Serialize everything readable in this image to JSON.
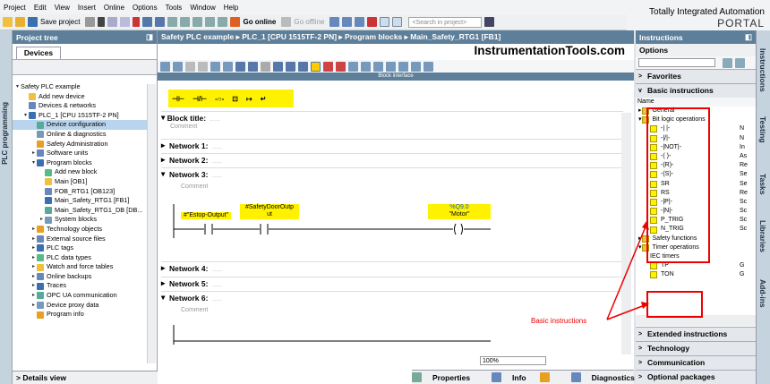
{
  "menu": [
    "Project",
    "Edit",
    "View",
    "Insert",
    "Online",
    "Options",
    "Tools",
    "Window",
    "Help"
  ],
  "brand": {
    "line1": "Totally Integrated Automation",
    "line2": "PORTAL"
  },
  "toolbar": {
    "save": "Save project",
    "go_online": "Go online",
    "go_offline": "Go offline",
    "search_placeholder": "<Search in project>"
  },
  "left_tab": "PLC programming",
  "project_tree": {
    "title": "Project tree",
    "tab": "Devices",
    "items": [
      {
        "label": "Safety PLC example",
        "level": 0,
        "arrow": "▾"
      },
      {
        "label": "Add new device",
        "level": 1,
        "arrow": ""
      },
      {
        "label": "Devices & networks",
        "level": 1,
        "arrow": ""
      },
      {
        "label": "PLC_1 [CPU 1515TF-2 PN]",
        "level": 1,
        "arrow": "▾"
      },
      {
        "label": "Device configuration",
        "level": 2,
        "arrow": "",
        "selected": true
      },
      {
        "label": "Online & diagnostics",
        "level": 2,
        "arrow": ""
      },
      {
        "label": "Safety Administration",
        "level": 2,
        "arrow": ""
      },
      {
        "label": "Software units",
        "level": 2,
        "arrow": "▸"
      },
      {
        "label": "Program blocks",
        "level": 2,
        "arrow": "▾"
      },
      {
        "label": "Add new block",
        "level": 3,
        "arrow": ""
      },
      {
        "label": "Main [OB1]",
        "level": 3,
        "arrow": ""
      },
      {
        "label": "FOB_RTG1 [OB123]",
        "level": 3,
        "arrow": ""
      },
      {
        "label": "Main_Safety_RTG1 [FB1]",
        "level": 3,
        "arrow": ""
      },
      {
        "label": "Main_Safety_RTG1_DB [DB...",
        "level": 3,
        "arrow": ""
      },
      {
        "label": "System blocks",
        "level": 3,
        "arrow": "▸"
      },
      {
        "label": "Technology objects",
        "level": 2,
        "arrow": "▸"
      },
      {
        "label": "External source files",
        "level": 2,
        "arrow": "▸"
      },
      {
        "label": "PLC tags",
        "level": 2,
        "arrow": "▸"
      },
      {
        "label": "PLC data types",
        "level": 2,
        "arrow": "▸"
      },
      {
        "label": "Watch and force tables",
        "level": 2,
        "arrow": "▸"
      },
      {
        "label": "Online backups",
        "level": 2,
        "arrow": "▸"
      },
      {
        "label": "Traces",
        "level": 2,
        "arrow": "▸"
      },
      {
        "label": "OPC UA communication",
        "level": 2,
        "arrow": "▸"
      },
      {
        "label": "Device proxy data",
        "level": 2,
        "arrow": "▸"
      },
      {
        "label": "Program info",
        "level": 2,
        "arrow": ""
      }
    ],
    "details": "Details view"
  },
  "editor": {
    "breadcrumb": "Safety PLC example  ▸  PLC_1 [CPU 1515TF-2 PN]  ▸  Program blocks  ▸  Main_Safety_RTG1 [FB1]",
    "watermark": "InstrumentationTools.com",
    "block_interface": "Block interface",
    "ladder_symbols": [
      "⊣⊢",
      "⊣/⊢",
      "-○-",
      "⊡",
      "↦",
      "↵"
    ],
    "block_title": "Block title:",
    "comment": "Comment",
    "network1": "Network 1:",
    "network2": "Network 2:",
    "network3": "Network 3:",
    "network4": "Network 4:",
    "network5": "Network 5:",
    "network6": "Network 6:",
    "dots": ".....",
    "contact1": "#\"Estop-Output\"",
    "contact2_l1": "#SafetyDoorOutp",
    "contact2_l2": "ut",
    "coil_addr": "%Q9.0",
    "coil_name": "\"Motor\"",
    "zoom": "100%"
  },
  "bottom": {
    "properties": "Properties",
    "info": "Info",
    "diagnostics": "Diagnostics"
  },
  "instructions": {
    "title": "Instructions",
    "options": "Options",
    "favorites": "Favorites",
    "basic": "Basic instructions",
    "name_col": "Name",
    "tree": [
      {
        "label": "General",
        "arrow": "▸"
      },
      {
        "label": "Bit logic operations",
        "arrow": "▾"
      }
    ],
    "bits": [
      {
        "label": "-| |-",
        "d": "N"
      },
      {
        "label": "-|/|-",
        "d": "N"
      },
      {
        "label": "-|NOT|-",
        "d": "In"
      },
      {
        "label": "-( )-",
        "d": "As"
      },
      {
        "label": "-(R)-",
        "d": "Re"
      },
      {
        "label": "-(S)-",
        "d": "Se"
      },
      {
        "label": "SR",
        "d": "Se"
      },
      {
        "label": "RS",
        "d": "Re"
      },
      {
        "label": "-|P|-",
        "d": "Sc"
      },
      {
        "label": "-|N|-",
        "d": "Sc"
      },
      {
        "label": "P_TRIG",
        "d": "Sc"
      },
      {
        "label": "N_TRIG",
        "d": "Sc"
      }
    ],
    "safety_functions": "Safety functions",
    "timer_ops": "Timer operations",
    "iec_timers": "IEC timers",
    "timers": [
      {
        "label": "TP",
        "d": "G"
      },
      {
        "label": "TON",
        "d": "G"
      }
    ],
    "panes": [
      "Extended instructions",
      "Technology",
      "Communication",
      "Optional packages"
    ]
  },
  "right_tabs": [
    "Instructions",
    "Testing",
    "Tasks",
    "Libraries",
    "Add-ins"
  ],
  "annotation": "Basic instructions"
}
